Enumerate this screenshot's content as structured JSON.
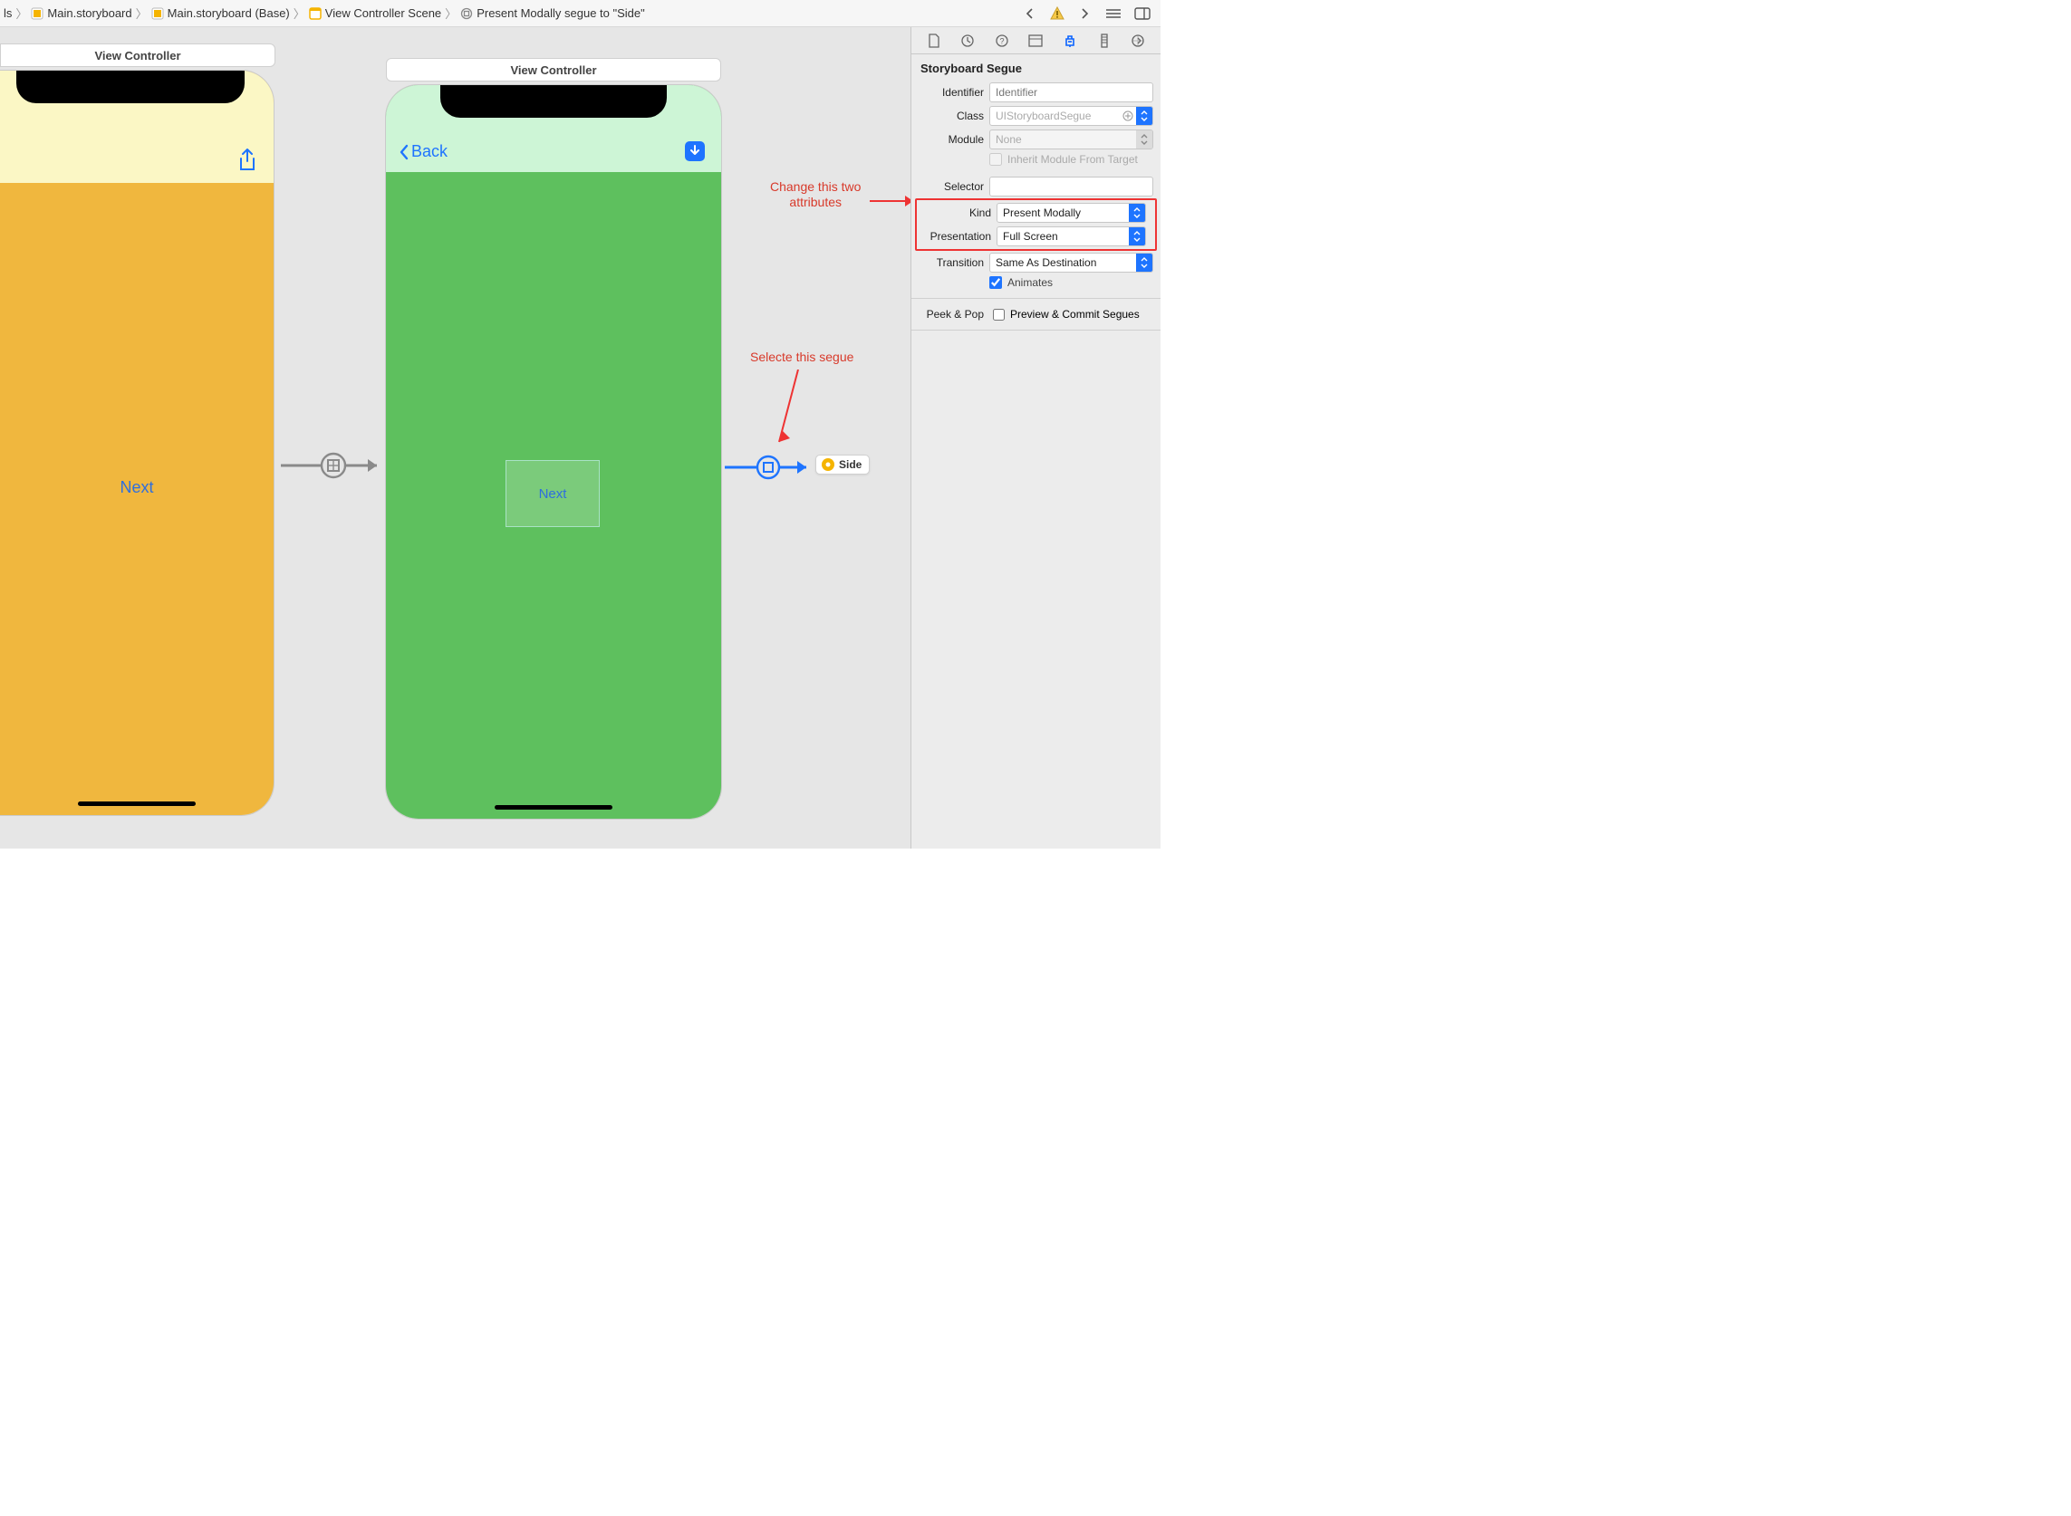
{
  "breadcrumb": {
    "item0": "ls",
    "item1": "Main.storyboard",
    "item2": "Main.storyboard (Base)",
    "item3": "View Controller Scene",
    "item4": "Present Modally segue to \"Side\""
  },
  "scenes": {
    "scene1_title": "View Controller",
    "scene2_title": "View Controller",
    "back_label": "Back",
    "next1_label": "Next",
    "next2_label": "Next",
    "side_chip": "Side"
  },
  "annotations": {
    "change_line1": "Change this two",
    "change_line2": "attributes",
    "select_segue": "Selecte this segue"
  },
  "inspector": {
    "section": "Storyboard Segue",
    "labels": {
      "identifier": "Identifier",
      "class": "Class",
      "module": "Module",
      "inherit": "Inherit Module From Target",
      "selector": "Selector",
      "kind": "Kind",
      "presentation": "Presentation",
      "transition": "Transition",
      "animates": "Animates",
      "peek": "Peek & Pop",
      "preview": "Preview & Commit Segues"
    },
    "values": {
      "identifier_placeholder": "Identifier",
      "class_placeholder": "UIStoryboardSegue",
      "module_placeholder": "None",
      "selector_value": "",
      "kind_value": "Present Modally",
      "presentation_value": "Full Screen",
      "transition_value": "Same As Destination",
      "animates_checked": true,
      "inherit_checked": false,
      "preview_checked": false
    }
  }
}
